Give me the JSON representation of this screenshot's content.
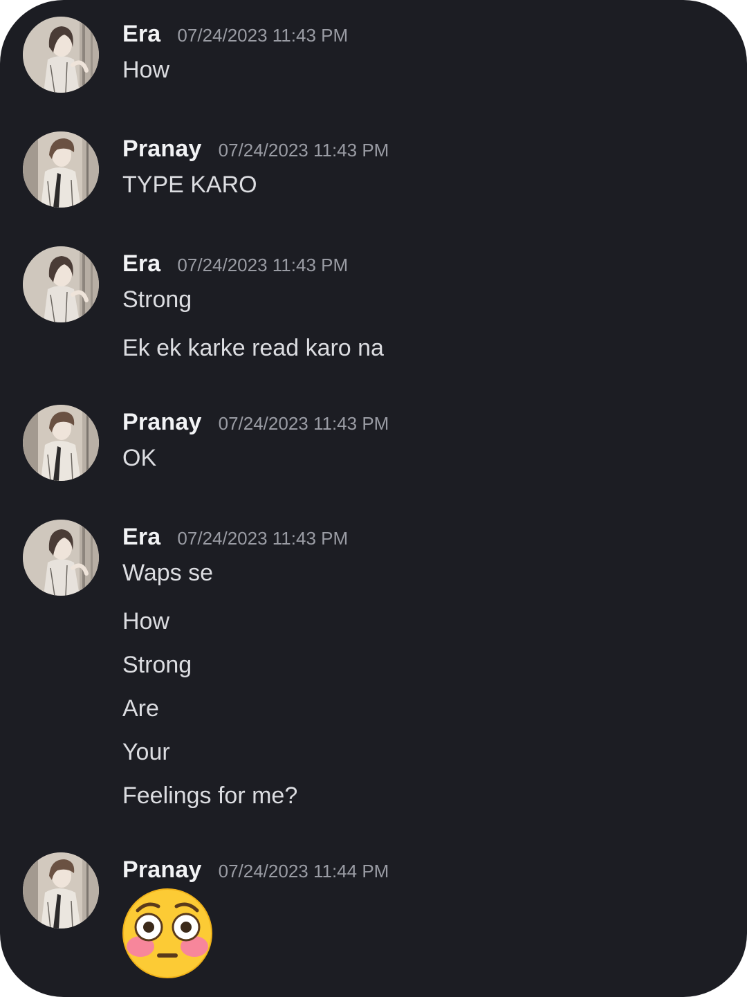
{
  "messages": [
    {
      "author": "Era",
      "timestamp": "07/24/2023 11:43 PM",
      "lines": [
        "How"
      ]
    },
    {
      "author": "Pranay",
      "timestamp": "07/24/2023 11:43 PM",
      "lines": [
        "TYPE KARO"
      ]
    },
    {
      "author": "Era",
      "timestamp": "07/24/2023 11:43 PM",
      "lines": [
        "Strong",
        "Ek ek karke read karo na"
      ]
    },
    {
      "author": "Pranay",
      "timestamp": "07/24/2023 11:43 PM",
      "lines": [
        "OK"
      ]
    },
    {
      "author": "Era",
      "timestamp": "07/24/2023 11:43 PM",
      "lines": [
        "Waps se",
        "How",
        "Strong",
        "Are",
        "Your",
        "Feelings for me?"
      ]
    },
    {
      "author": "Pranay",
      "timestamp": "07/24/2023 11:44 PM",
      "emoji": "flushed-face-emoji"
    }
  ],
  "colors": {
    "background": "#1c1d23",
    "username": "#f2f3f5",
    "timestamp": "#9a9ca4",
    "message_text": "#dcdde1"
  }
}
